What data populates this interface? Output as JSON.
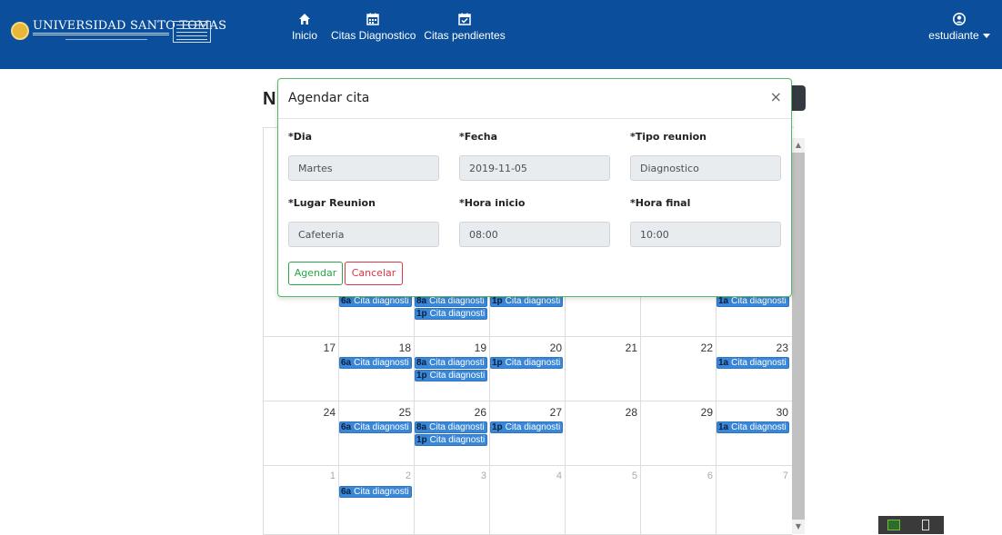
{
  "navbar": {
    "logo_text": "UNIVERSIDAD SANTO TOMAS",
    "links": [
      {
        "label": "Inicio",
        "icon": "home-icon"
      },
      {
        "label": "Citas Diagnostico",
        "icon": "calendar-icon"
      },
      {
        "label": "Citas pendientes",
        "icon": "calendar-check-icon"
      }
    ],
    "user": {
      "label": "estudiante",
      "icon": "user-circle-icon"
    },
    "color": "#0b4f9c"
  },
  "page": {
    "title_initial": "N"
  },
  "modal": {
    "title": "Agendar cita",
    "close": "×",
    "fields": [
      {
        "label": "*Dia",
        "value": "Martes"
      },
      {
        "label": "*Fecha",
        "value": "2019-11-05"
      },
      {
        "label": "*Tipo reunion",
        "value": "Diagnostico"
      },
      {
        "label": "*Lugar Reunion",
        "value": "Cafeteria"
      },
      {
        "label": "*Hora inicio",
        "value": "08:00"
      },
      {
        "label": "*Hora final",
        "value": "10:00"
      }
    ],
    "buttons": {
      "agendar": "Agendar",
      "cancelar": "Cancelar"
    }
  },
  "calendar": {
    "event_color": "#3a87d8",
    "rows": [
      {
        "days": [
          {
            "n": ""
          },
          {
            "n": ""
          },
          {
            "n": ""
          },
          {
            "n": ""
          },
          {
            "n": ""
          },
          {
            "n": ""
          },
          {
            "n": ""
          }
        ],
        "events": [
          {
            "day": 1,
            "time": "6a",
            "title": "Cita diagnosti",
            "slot": 0
          },
          {
            "day": 2,
            "time": "8a",
            "title": "Cita diagnosti",
            "slot": 0
          },
          {
            "day": 2,
            "time": "1p",
            "title": "Cita diagnosti",
            "slot": 1
          },
          {
            "day": 3,
            "time": "1p",
            "title": "Cita diagnosti",
            "slot": 0
          },
          {
            "day": 6,
            "time": "1a",
            "title": "Cita diagnosti",
            "slot": 0
          }
        ]
      },
      {
        "days": [
          {
            "n": "17"
          },
          {
            "n": "18"
          },
          {
            "n": "19"
          },
          {
            "n": "20"
          },
          {
            "n": "21"
          },
          {
            "n": "22"
          },
          {
            "n": "23"
          }
        ],
        "events": [
          {
            "day": 1,
            "time": "6a",
            "title": "Cita diagnosti",
            "slot": 0
          },
          {
            "day": 2,
            "time": "8a",
            "title": "Cita diagnosti",
            "slot": 0
          },
          {
            "day": 2,
            "time": "1p",
            "title": "Cita diagnosti",
            "slot": 1
          },
          {
            "day": 3,
            "time": "1p",
            "title": "Cita diagnosti",
            "slot": 0
          },
          {
            "day": 6,
            "time": "1a",
            "title": "Cita diagnosti",
            "slot": 0
          }
        ]
      },
      {
        "days": [
          {
            "n": "24"
          },
          {
            "n": "25"
          },
          {
            "n": "26"
          },
          {
            "n": "27"
          },
          {
            "n": "28"
          },
          {
            "n": "29"
          },
          {
            "n": "30"
          }
        ],
        "events": [
          {
            "day": 1,
            "time": "6a",
            "title": "Cita diagnosti",
            "slot": 0
          },
          {
            "day": 2,
            "time": "8a",
            "title": "Cita diagnosti",
            "slot": 0
          },
          {
            "day": 2,
            "time": "1p",
            "title": "Cita diagnosti",
            "slot": 1
          },
          {
            "day": 3,
            "time": "1p",
            "title": "Cita diagnosti",
            "slot": 0
          },
          {
            "day": 6,
            "time": "1a",
            "title": "Cita diagnosti",
            "slot": 0
          }
        ]
      },
      {
        "days": [
          {
            "n": "1",
            "other": true
          },
          {
            "n": "2",
            "other": true
          },
          {
            "n": "3",
            "other": true
          },
          {
            "n": "4",
            "other": true
          },
          {
            "n": "5",
            "other": true
          },
          {
            "n": "6",
            "other": true
          },
          {
            "n": "7",
            "other": true
          }
        ],
        "events": [
          {
            "day": 1,
            "time": "6a",
            "title": "Cita diagnosti",
            "slot": 0
          }
        ]
      }
    ]
  }
}
